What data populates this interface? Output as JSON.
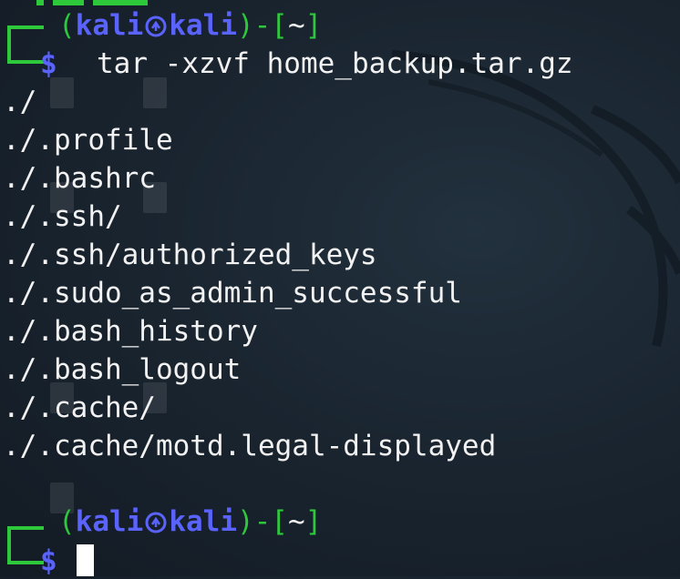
{
  "prompt": {
    "open": "(",
    "user": "kali",
    "host": "kali",
    "close_dash": ")-[",
    "dir": "~",
    "dir_close": "]",
    "dollar": "$"
  },
  "command": "tar -xzvf home_backup.tar.gz",
  "output": [
    "./",
    "./.profile",
    "./.bashrc",
    "./.ssh/",
    "./.ssh/authorized_keys",
    "./.sudo_as_admin_successful",
    "./.bash_history",
    "./.bash_logout",
    "./.cache/",
    "./.cache/motd.legal-displayed"
  ],
  "colors": {
    "prompt_green": "#2ec83b",
    "prompt_blue": "#5b63ff",
    "text": "#f2f2f2",
    "background": "#1a2530"
  },
  "icons": {
    "user_host_separator": "kali-skull-icon",
    "cursor": "block-cursor"
  }
}
